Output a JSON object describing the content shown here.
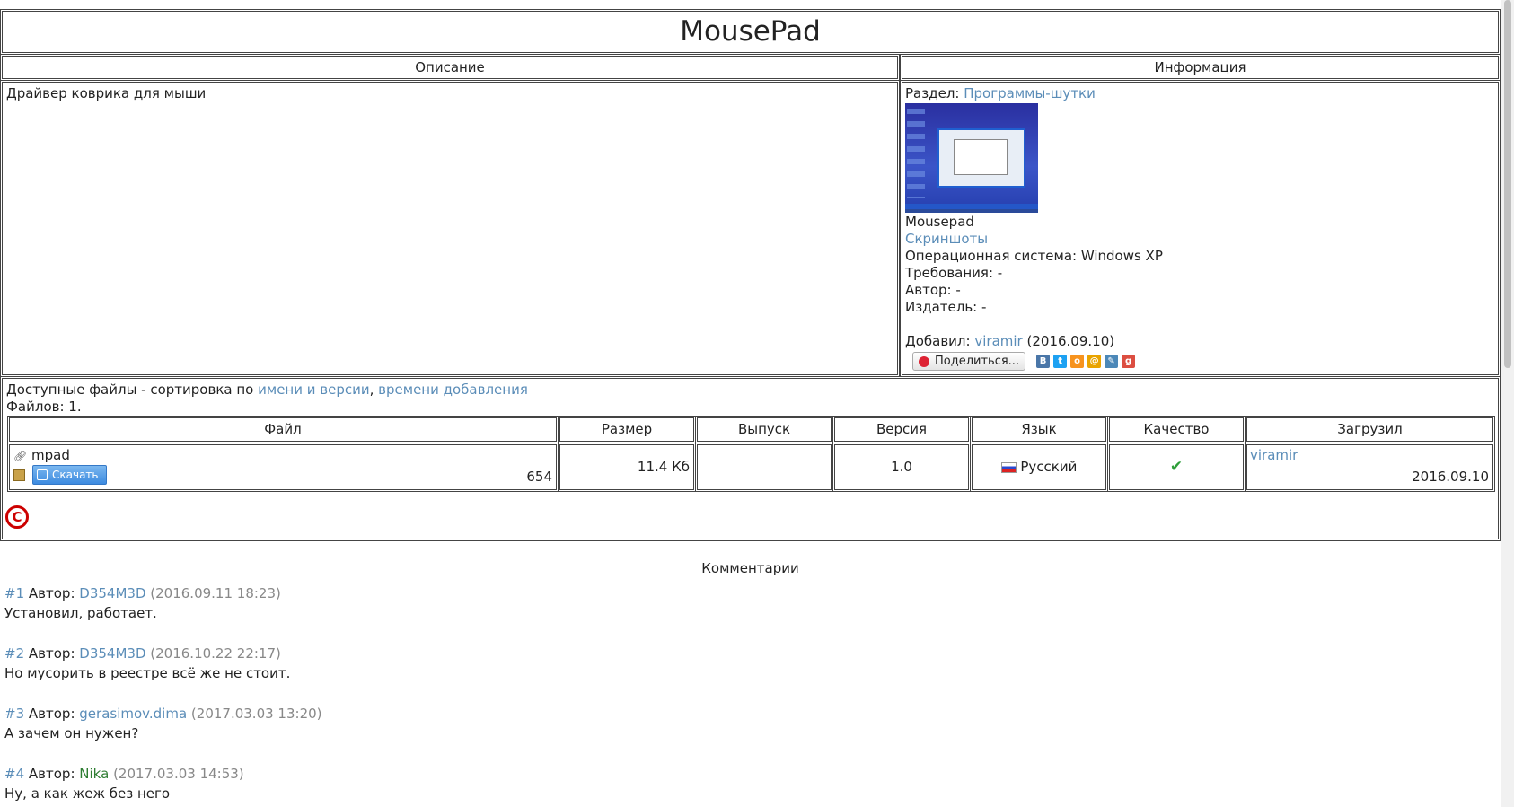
{
  "title": "MousePad",
  "headers": {
    "description": "Описание",
    "info": "Информация"
  },
  "description": "Драйвер коврика для мыши",
  "info": {
    "section_label": "Раздел:",
    "section_link": "Программы-шутки",
    "thumb_caption": "Mousepad",
    "screenshots_link": "Скриншоты",
    "os": "Операционная система: Windows XP",
    "requirements": "Требования: -",
    "author": "Автор: -",
    "publisher": "Издатель: -",
    "added_label": "Добавил:",
    "added_user": "viramir",
    "added_date": "(2016.09.10)",
    "share_label": "Поделиться...",
    "share_icons": [
      "vk-icon",
      "twitter-icon",
      "odnoklassniki-icon",
      "mailru-icon",
      "livejournal-icon",
      "googleplus-icon"
    ]
  },
  "files": {
    "intro": "Доступные файлы - сортировка по",
    "sort_name": "имени и версии",
    "sort_sep": ",",
    "sort_time": "времени добавления",
    "count": "Файлов: 1.",
    "columns": [
      "Файл",
      "Размер",
      "Выпуск",
      "Версия",
      "Язык",
      "Качество",
      "Загрузил"
    ],
    "row": {
      "name": "mpad",
      "download_label": "Скачать",
      "downloads": "654",
      "size": "11.4 Кб",
      "release": "",
      "version": "1.0",
      "language": "Русский",
      "quality": "✔",
      "uploader": "viramir",
      "upload_date": "2016.09.10"
    }
  },
  "comments_title": "Комментарии",
  "comments": [
    {
      "num": "#1",
      "author_label": "Автор:",
      "author": "D354M3D",
      "date": "(2016.09.11 18:23)",
      "text": "Установил, работает."
    },
    {
      "num": "#2",
      "author_label": "Автор:",
      "author": "D354M3D",
      "date": "(2016.10.22 22:17)",
      "text": "Но мусорить в реестре всё же не стоит."
    },
    {
      "num": "#3",
      "author_label": "Автор:",
      "author": "gerasimov.dima",
      "date": "(2017.03.03 13:20)",
      "text": "А зачем он нужен?"
    },
    {
      "num": "#4",
      "author_label": "Автор:",
      "author": "Nika",
      "date": "(2017.03.03 14:53)",
      "text": "Ну, а как жеж без него"
    }
  ],
  "colors": {
    "link": "#5b8db8",
    "nika": "#2e7d32",
    "copyright": "#cc0000",
    "check": "#2e9e3a"
  }
}
